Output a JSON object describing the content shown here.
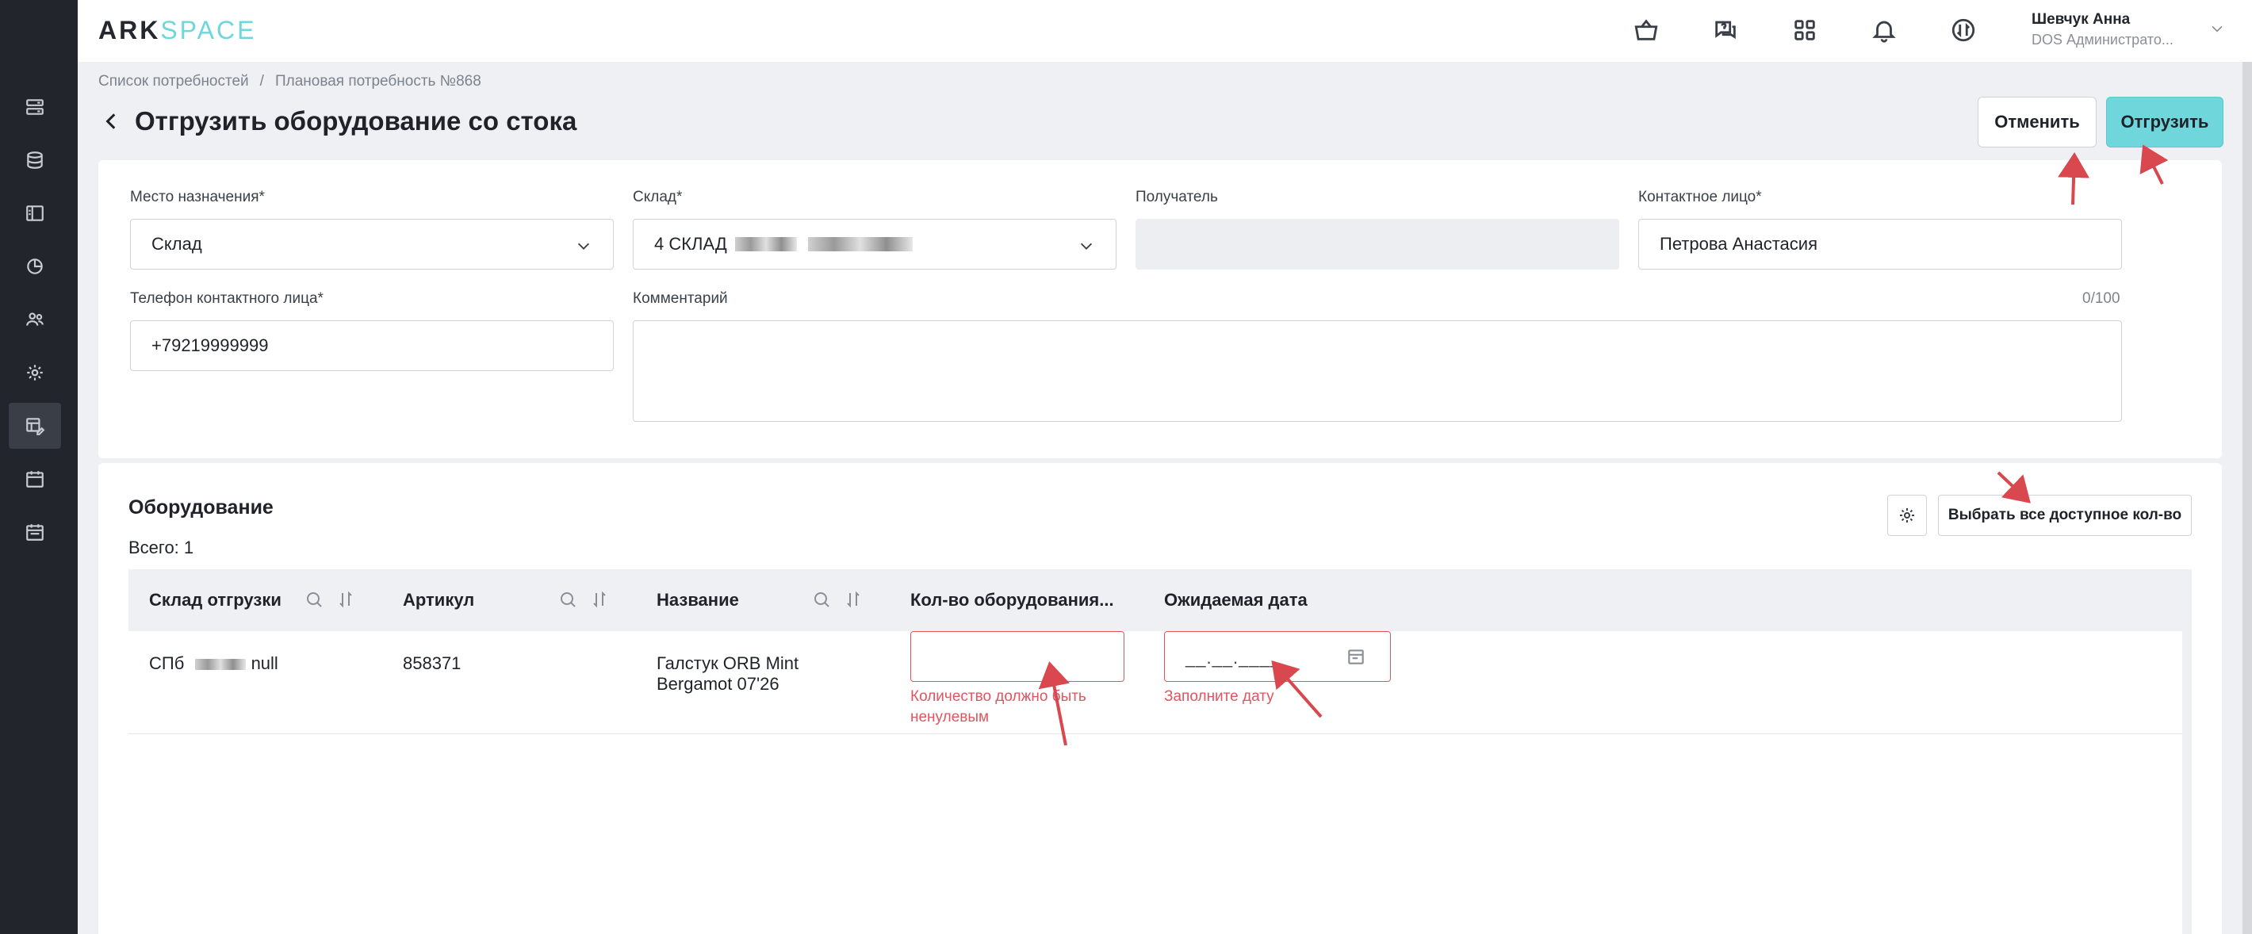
{
  "app": {
    "logo_ark": "ARK",
    "logo_space": "SPACE"
  },
  "user": {
    "name": "Шевчук Анна",
    "role": "DOS Администрато..."
  },
  "breadcrumb": {
    "items": [
      "Список потребностей",
      "Плановая потребность №868"
    ],
    "separator": "/"
  },
  "page": {
    "title": "Отгрузить оборудование со стока"
  },
  "actions": {
    "cancel_label": "Отменить",
    "ship_label": "Отгрузить"
  },
  "form": {
    "destination": {
      "label": "Место назначения*",
      "value": "Склад"
    },
    "warehouse": {
      "label": "Склад*",
      "value": "4 СКЛАД"
    },
    "recipient": {
      "label": "Получатель",
      "value": ""
    },
    "contact": {
      "label": "Контактное лицо*",
      "value": "Петрова Анастасия"
    },
    "phone": {
      "label": "Телефон контактного лица*",
      "value": "+79219999999"
    },
    "comment": {
      "label": "Комментарий",
      "value": "",
      "counter": "0/100"
    }
  },
  "equipment": {
    "title": "Оборудование",
    "total": "Всего: 1",
    "select_all_label": "Выбрать все доступное кол-во",
    "columns": [
      "Склад отгрузки",
      "Артикул",
      "Название",
      "Кол-во оборудования...",
      "Ожидаемая дата"
    ],
    "rows": [
      {
        "warehouse_prefix": "СПб",
        "warehouse_suffix": "null",
        "article": "858371",
        "name_line1": "Галстук ORB Mint",
        "name_line2": "Bergamot 07'26",
        "qty_value": "",
        "qty_error_line1": "Количество должно быть",
        "qty_error_line2": "ненулевым",
        "date_placeholder": "__.__.____",
        "date_error": "Заполните дату"
      }
    ]
  },
  "colors": {
    "accent": "#6fd6db",
    "error": "#e0555e",
    "sidebar": "#22252b",
    "annotation": "#d9474f"
  }
}
